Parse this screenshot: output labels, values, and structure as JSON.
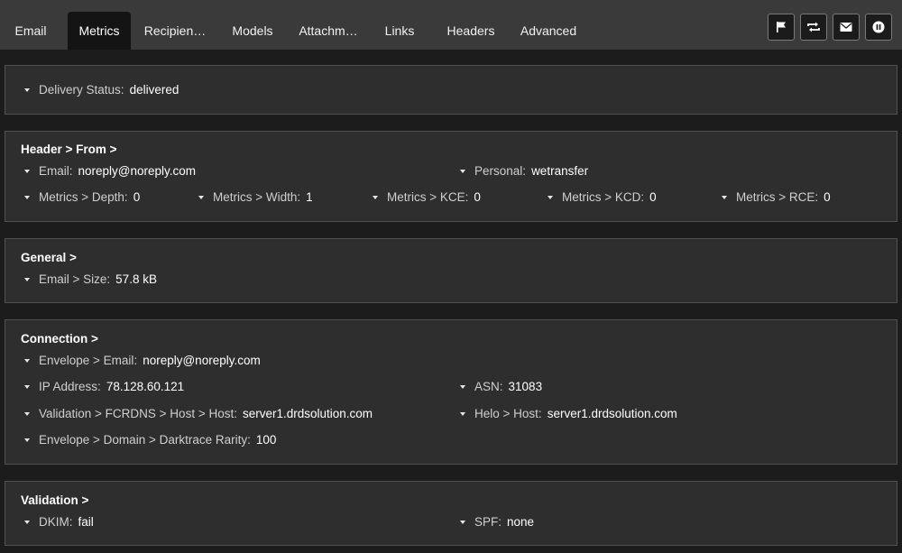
{
  "tabs": [
    {
      "label": "Email"
    },
    {
      "label": "Metrics"
    },
    {
      "label": "Recipien…"
    },
    {
      "label": "Models"
    },
    {
      "label": "Attachm…"
    },
    {
      "label": "Links"
    },
    {
      "label": "Headers"
    },
    {
      "label": "Advanced"
    }
  ],
  "toolbar": {
    "icons": [
      "flag-icon",
      "repeat-icon",
      "envelope-icon",
      "pause-icon"
    ]
  },
  "delivery": {
    "status_label": "Delivery Status",
    "status_value": "delivered"
  },
  "header_from": {
    "title": "Header > From >",
    "email_label": "Email",
    "email_value": "noreply@noreply.com",
    "personal_label": "Personal",
    "personal_value": "wetransfer",
    "metrics": [
      {
        "label": "Metrics > Depth",
        "value": "0"
      },
      {
        "label": "Metrics > Width",
        "value": "1"
      },
      {
        "label": "Metrics > KCE",
        "value": "0"
      },
      {
        "label": "Metrics > KCD",
        "value": "0"
      },
      {
        "label": "Metrics > RCE",
        "value": "0"
      }
    ]
  },
  "general": {
    "title": "General >",
    "size_label": "Email > Size",
    "size_value": "57.8 kB"
  },
  "connection": {
    "title": "Connection >",
    "envelope_email_label": "Envelope > Email",
    "envelope_email_value": "noreply@noreply.com",
    "ip_label": "IP Address",
    "ip_value": "78.128.60.121",
    "asn_label": "ASN",
    "asn_value": "31083",
    "fcrdns_label": "Validation > FCRDNS > Host > Host",
    "fcrdns_value": "server1.drdsolution.com",
    "helo_label": "Helo > Host",
    "helo_value": "server1.drdsolution.com",
    "rarity_label": "Envelope > Domain > Darktrace Rarity",
    "rarity_value": "100"
  },
  "validation": {
    "title": "Validation >",
    "dkim_label": "DKIM",
    "dkim_value": "fail",
    "spf_label": "SPF",
    "spf_value": "none"
  }
}
